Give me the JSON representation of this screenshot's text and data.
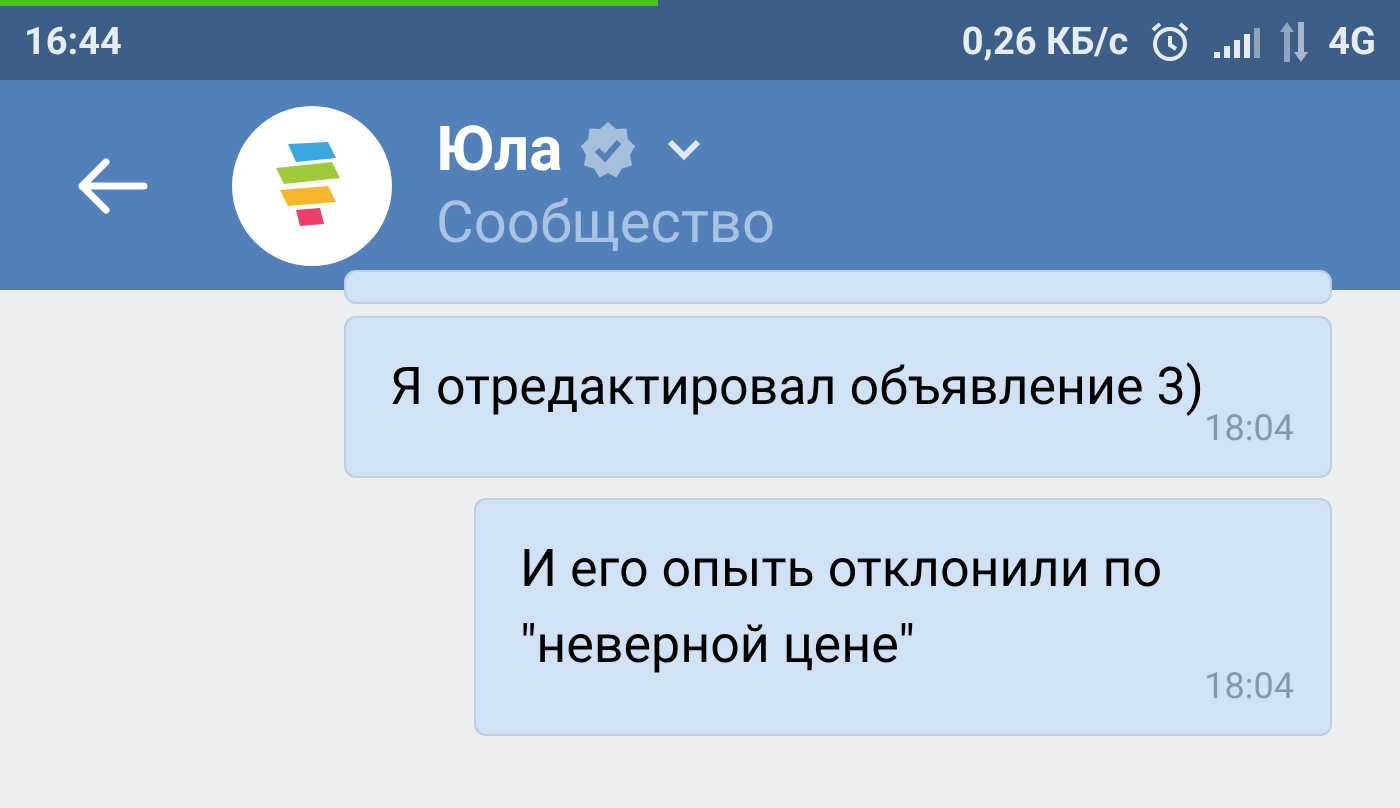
{
  "status_bar": {
    "time": "16:44",
    "speed": "0,26 КБ/с",
    "network": "4G",
    "progress": {
      "level": 0.47
    }
  },
  "header": {
    "title": "Юла",
    "subtitle": "Сообщество"
  },
  "messages": [
    {
      "text": "Я отредактировал объявление 3)",
      "time": "18:04"
    },
    {
      "text": "И его опыть отклонили по \"неверной цене\"",
      "time": "18:04"
    }
  ]
}
